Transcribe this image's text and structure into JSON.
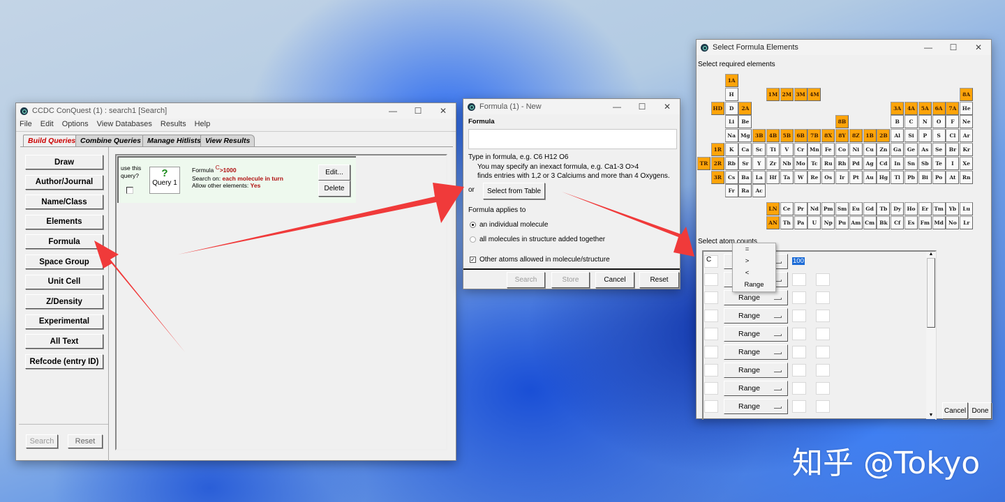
{
  "main_window": {
    "title": "CCDC ConQuest (1) : search1 [Search]",
    "menu": [
      "File",
      "Edit",
      "Options",
      "View Databases",
      "Results",
      "Help"
    ],
    "tabs": [
      "Build Queries",
      "Combine Queries",
      "Manage Hitlists",
      "View Results"
    ],
    "side_buttons": [
      "Draw",
      "Author/Journal",
      "Name/Class",
      "Elements",
      "Formula",
      "Space Group",
      "Unit Cell",
      "Z/Density",
      "Experimental",
      "All Text",
      "Refcode (entry ID)"
    ],
    "search_label": "Search",
    "reset_label": "Reset",
    "query": {
      "use_label": "use this query?",
      "icon": "?",
      "name": "Query 1",
      "formula_label": "Formula",
      "formula_elem": "C",
      "formula_cond": ">1000",
      "search_on_label": "Search on:",
      "search_on_value": "each molecule in turn",
      "allow_label": "Allow other elements:",
      "allow_value": "Yes",
      "edit_label": "Edit...",
      "delete_label": "Delete"
    }
  },
  "formula_dialog": {
    "title": "Formula (1) - New",
    "heading": "Formula",
    "value": "",
    "help1": "Type in formula, e.g. C6 H12 O6",
    "help2": "You may specify an inexact formula, e.g. Ca1-3 O>4",
    "help3": "finds entries with 1,2 or 3 Calciums and more than 4 Oxygens.",
    "or": "or",
    "select_table": "Select from Table",
    "applies_label": "Formula applies to",
    "radio1": "an individual molecule",
    "radio2": "all molecules in structure added together",
    "radio_selected": 1,
    "check_label": "Other atoms allowed in molecule/structure",
    "checked": true,
    "buttons": [
      "Search",
      "Store",
      "Cancel",
      "Reset"
    ]
  },
  "elements_dialog": {
    "title": "Select Formula Elements",
    "required_label": "Select required elements",
    "counts_label": "Select atom counts",
    "table": [
      [
        "",
        "",
        "1A",
        "",
        "",
        "",
        "",
        "",
        "",
        "",
        "",
        "",
        "",
        "",
        "",
        "",
        "",
        "",
        "",
        ""
      ],
      [
        "",
        "",
        "H",
        "",
        "",
        "1M",
        "2M",
        "3M",
        "4M",
        "",
        "",
        "",
        "",
        "",
        "",
        "",
        "",
        "",
        "",
        "8A"
      ],
      [
        "",
        "HD",
        "D",
        "2A",
        "",
        "",
        "",
        "",
        "",
        "",
        "",
        "",
        "",
        "",
        "3A",
        "4A",
        "5A",
        "6A",
        "7A",
        "He"
      ],
      [
        "",
        "",
        "Li",
        "Be",
        "",
        "",
        "",
        "",
        "",
        "",
        "8B",
        "",
        "",
        "",
        "B",
        "C",
        "N",
        "O",
        "F",
        "Ne"
      ],
      [
        "",
        "",
        "Na",
        "Mg",
        "3B",
        "4B",
        "5B",
        "6B",
        "7B",
        "8X",
        "8Y",
        "8Z",
        "1B",
        "2B",
        "Al",
        "Si",
        "P",
        "S",
        "Cl",
        "Ar"
      ],
      [
        "",
        "1R",
        "K",
        "Ca",
        "Sc",
        "Ti",
        "V",
        "Cr",
        "Mn",
        "Fe",
        "Co",
        "Ni",
        "Cu",
        "Zn",
        "Ga",
        "Ge",
        "As",
        "Se",
        "Br",
        "Kr"
      ],
      [
        "TR",
        "2R",
        "Rb",
        "Sr",
        "Y",
        "Zr",
        "Nb",
        "Mo",
        "Tc",
        "Ru",
        "Rh",
        "Pd",
        "Ag",
        "Cd",
        "In",
        "Sn",
        "Sb",
        "Te",
        "I",
        "Xe"
      ],
      [
        "",
        "3R",
        "Cs",
        "Ba",
        "La",
        "Hf",
        "Ta",
        "W",
        "Re",
        "Os",
        "Ir",
        "Pt",
        "Au",
        "Hg",
        "Tl",
        "Pb",
        "Bi",
        "Po",
        "At",
        "Rn"
      ],
      [
        "",
        "",
        "Fr",
        "Ra",
        "Ac",
        "",
        "",
        "",
        "",
        "",
        "",
        "",
        "",
        "",
        "",
        "",
        "",
        "",
        "",
        ""
      ],
      [
        "",
        "",
        "",
        "",
        "",
        "LN",
        "Ce",
        "Pr",
        "Nd",
        "Pm",
        "Sm",
        "Eu",
        "Gd",
        "Tb",
        "Dy",
        "Ho",
        "Er",
        "Tm",
        "Yb",
        "Lu"
      ],
      [
        "",
        "",
        "",
        "",
        "",
        "AN",
        "Th",
        "Pa",
        "U",
        "Np",
        "Pu",
        "Am",
        "Cm",
        "Bk",
        "Cf",
        "Es",
        "Fm",
        "Md",
        "No",
        "Lr"
      ]
    ],
    "highlighted": [
      "1A",
      "1M",
      "2M",
      "3M",
      "4M",
      "8A",
      "HD",
      "2A",
      "3A",
      "4A",
      "5A",
      "6A",
      "7A",
      "8B",
      "3B",
      "4B",
      "5B",
      "6B",
      "7B",
      "8X",
      "8Y",
      "8Z",
      "1B",
      "2B",
      "1R",
      "TR",
      "2R",
      "3R",
      "LN",
      "AN"
    ],
    "highlight_color": "#ffa40a",
    "rows": [
      {
        "element": "C",
        "op": "",
        "v1": "100",
        "v2": ""
      },
      {
        "element": "",
        "op": "",
        "v1": "",
        "v2": ""
      },
      {
        "element": "",
        "op": "Range",
        "v1": "",
        "v2": ""
      },
      {
        "element": "",
        "op": "Range",
        "v1": "",
        "v2": ""
      },
      {
        "element": "",
        "op": "Range",
        "v1": "",
        "v2": ""
      },
      {
        "element": "",
        "op": "Range",
        "v1": "",
        "v2": ""
      },
      {
        "element": "",
        "op": "Range",
        "v1": "",
        "v2": ""
      },
      {
        "element": "",
        "op": "Range",
        "v1": "",
        "v2": ""
      },
      {
        "element": "",
        "op": "Range",
        "v1": "",
        "v2": ""
      }
    ],
    "popup_options": [
      "=",
      ">",
      "<",
      "Range"
    ],
    "cancel_label": "Cancel",
    "done_label": "Done"
  },
  "watermark": "知乎 @Tokyo",
  "arrow_color": "#f03a3a"
}
